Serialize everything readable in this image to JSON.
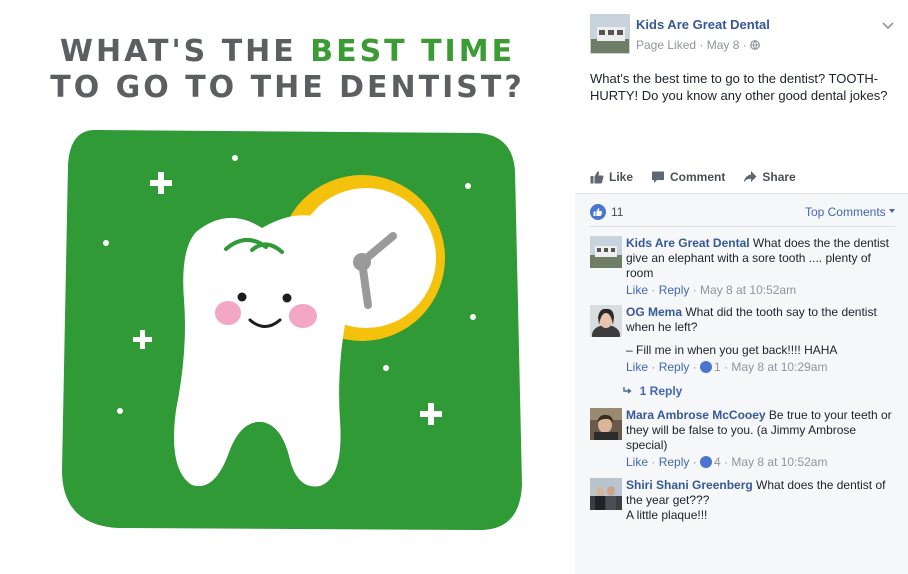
{
  "image": {
    "headline": {
      "part1": "WHAT'S THE ",
      "accent": "BEST TIME",
      "line2": "TO GO TO THE DENTIST?"
    },
    "colors": {
      "headline_gray": "#5c5f60",
      "headline_green": "#3b9b34",
      "background_green": "#2f9a36",
      "clock_yellow": "#f4c20d",
      "tooth_white": "#ffffff",
      "cheek_pink": "#f3a7c2"
    },
    "icons": [
      "sparkle-icon",
      "tooth-character",
      "clock-icon"
    ]
  },
  "post": {
    "page_name": "Kids Are Great Dental",
    "meta": "Page Liked · May 8 ·",
    "text": "What's the best time to go to the dentist? TOOTH-HURTY! Do you know any other good dental jokes?",
    "actions": [
      {
        "label": "Like",
        "icon": "thumbs-up-icon"
      },
      {
        "label": "Comment",
        "icon": "comment-icon"
      },
      {
        "label": "Share",
        "icon": "share-arrow-icon"
      }
    ],
    "like_count": "11",
    "sort_label": "Top Comments",
    "colors": {
      "link_blue": "#365899",
      "meta_gray": "#90949c",
      "like_blue": "#4a76d0",
      "comments_bg": "#f6f7f9"
    }
  },
  "comments": [
    {
      "author": "Kids Are Great Dental",
      "text": " What does the the dentist give an elephant with a sore tooth .... plenty of room",
      "like": "Like",
      "reply": "Reply",
      "reactions": "",
      "time": "May 8 at 10:52am"
    },
    {
      "author": "OG Mema",
      "text": " What did the tooth say to the dentist when he left?",
      "text2": "– Fill me in when you get back!!!! HAHA",
      "like": "Like",
      "reply": "Reply",
      "reactions": "1",
      "time": "May 8 at 10:29am",
      "replies_link": "1 Reply"
    },
    {
      "author": "Mara Ambrose McCooey",
      "text": " Be true to your teeth or they will be false to you. (a Jimmy Ambrose special)",
      "like": "Like",
      "reply": "Reply",
      "reactions": "4",
      "time": "May 8 at 10:52am"
    },
    {
      "author": "Shiri Shani Greenberg",
      "text": " What does the dentist of the year get???",
      "text2": "A little plaque!!!",
      "like": "Like",
      "reply": "Reply",
      "reactions": "",
      "time": ""
    }
  ]
}
